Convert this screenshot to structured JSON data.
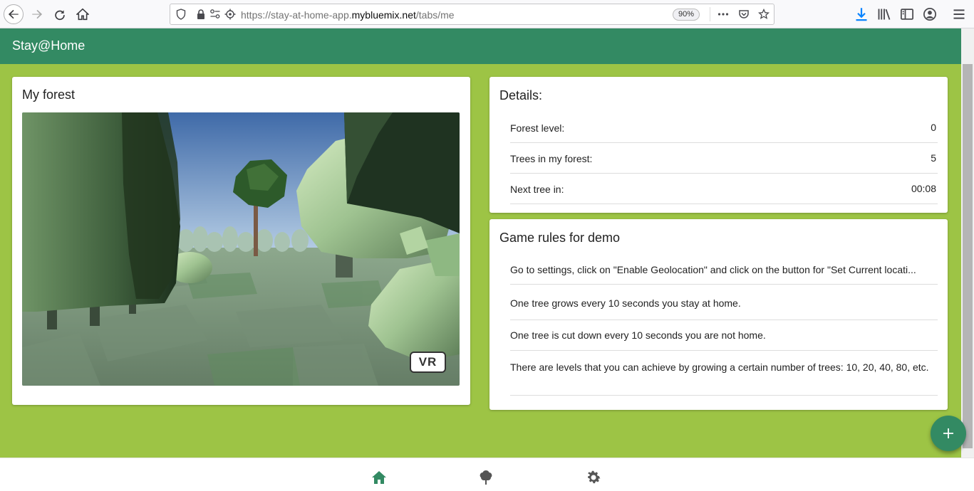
{
  "browser": {
    "url_prefix": "https://stay-at-home-app.",
    "url_domain": "mybluemix.net",
    "url_path": "/tabs/me",
    "zoom": "90%"
  },
  "app": {
    "title": "Stay@Home"
  },
  "forest": {
    "title": "My forest",
    "vr_label": "VR"
  },
  "details": {
    "title": "Details:",
    "rows": [
      {
        "label": "Forest level:",
        "value": "0"
      },
      {
        "label": "Trees in my forest:",
        "value": "5"
      },
      {
        "label": "Next tree in:",
        "value": "00:08"
      }
    ]
  },
  "rules": {
    "title": "Game rules for demo",
    "items": [
      "Go to settings, click on \"Enable Geolocation\" and click on the button for \"Set Current locati...",
      "One tree grows every 10 seconds you stay at home.",
      "One tree is cut down every 10 seconds you are not home.",
      "There are levels that you can achieve by growing a certain number of trees: 10, 20, 40, 80, etc."
    ]
  },
  "colors": {
    "header": "#338a63",
    "background": "#9dc445",
    "fab": "#338a63",
    "tab_active": "#338a63",
    "tab_inactive": "#555555"
  },
  "icons": {
    "fab": "plus-icon",
    "tabs": [
      "home-icon",
      "tree-icon",
      "settings-gear-icon"
    ]
  }
}
